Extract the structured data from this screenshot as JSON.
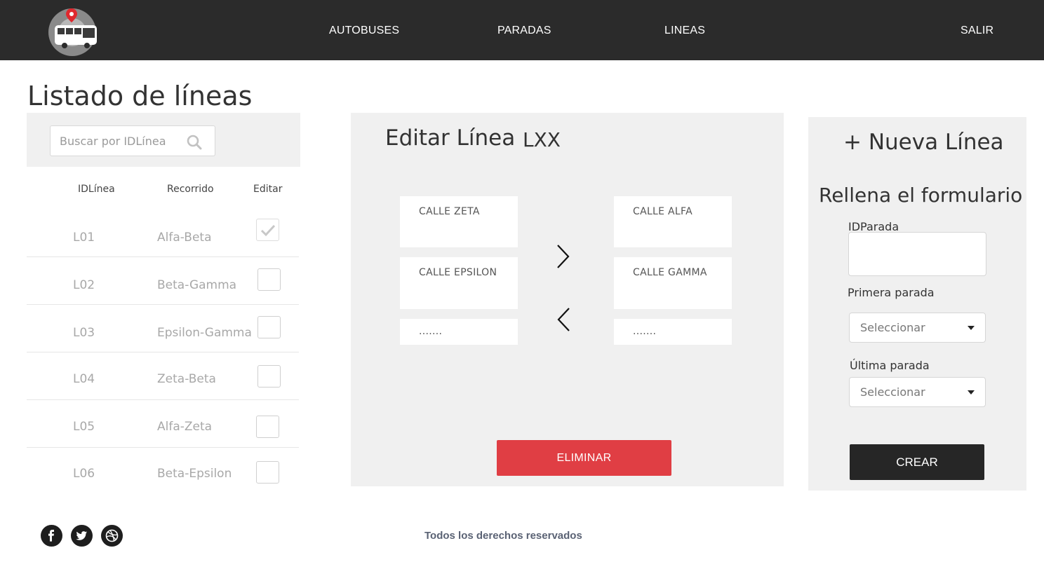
{
  "nav": {
    "logo_icon": "bus-location-logo-icon",
    "links": [
      "AUTOBUSES",
      "PARADAS",
      "LINEAS",
      "SALIR"
    ]
  },
  "page_title": "Listado de líneas",
  "search": {
    "placeholder": "Buscar por IDLínea",
    "icon": "search-icon"
  },
  "table": {
    "headers": [
      "IDLínea",
      "Recorrido",
      "Editar"
    ],
    "rows": [
      {
        "id": "L01",
        "recorrido": "Alfa-Beta",
        "checked": true
      },
      {
        "id": "L02",
        "recorrido": "Beta-Gamma",
        "checked": false
      },
      {
        "id": "L03",
        "recorrido": "Epsilon-Gamma",
        "checked": false
      },
      {
        "id": "L04",
        "recorrido": "Zeta-Beta",
        "checked": false
      },
      {
        "id": "L05",
        "recorrido": "Alfa-Zeta",
        "checked": false
      },
      {
        "id": "L06",
        "recorrido": "Beta-Epsilon",
        "checked": false
      }
    ]
  },
  "edit": {
    "title": "Editar Línea",
    "code": "LXX",
    "left_streets": [
      "CALLE ZETA",
      "CALLE EPSILON",
      "......."
    ],
    "right_streets": [
      "CALLE ALFA",
      "CALLE GAMMA",
      "......."
    ],
    "move_right_icon": "chevron-right-icon",
    "move_left_icon": "chevron-left-icon",
    "delete_label": "ELIMINAR"
  },
  "new_line": {
    "title": "+ Nueva Línea",
    "form_title": "Rellena el formulario",
    "id_label": "IDParada",
    "id_value": "",
    "first_stop_label": "Primera parada",
    "first_stop_value": "Seleccionar",
    "last_stop_label": "Última parada",
    "last_stop_value": "Seleccionar",
    "create_label": "CREAR"
  },
  "footer": {
    "social_icons": [
      "facebook-icon",
      "twitter-icon",
      "dribbble-icon"
    ],
    "copyright": "Todos los derechos reservados"
  },
  "colors": {
    "navbar": "#2b2b2b",
    "panel": "#f0f0f0",
    "delete": "#e03e44",
    "create": "#262626",
    "logo_pin": "#e0282e"
  }
}
